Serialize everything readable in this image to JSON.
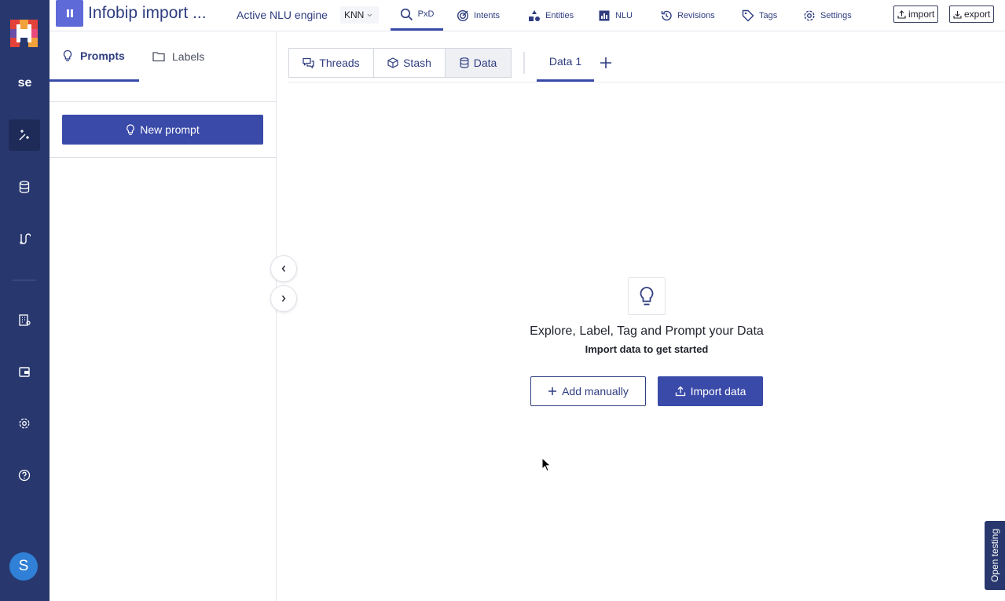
{
  "app": {
    "project_title": "Infobip import ...",
    "workspace_abbr": "se",
    "user_initial": "S"
  },
  "header": {
    "engine_label": "Active NLU engine",
    "engine_value": "KNN",
    "nav": [
      {
        "label": "PxD",
        "icon": "search-icon",
        "active": true
      },
      {
        "label": "Intents",
        "icon": "target-icon"
      },
      {
        "label": "Entities",
        "icon": "shapes-icon"
      },
      {
        "label": "NLU",
        "icon": "bar-chart-icon"
      },
      {
        "label": "Revisions",
        "icon": "history-icon"
      },
      {
        "label": "Tags",
        "icon": "tag-icon"
      },
      {
        "label": "Settings",
        "icon": "gear-icon"
      }
    ],
    "import_label": "import",
    "export_label": "export"
  },
  "left_panel": {
    "tabs": [
      {
        "label": "Prompts",
        "icon": "lightbulb-icon",
        "active": true
      },
      {
        "label": "Labels",
        "icon": "folder-icon"
      }
    ],
    "new_prompt_label": "New prompt"
  },
  "main": {
    "segments": [
      {
        "label": "Threads",
        "icon": "chat-icon"
      },
      {
        "label": "Stash",
        "icon": "box-icon"
      },
      {
        "label": "Data",
        "icon": "database-icon",
        "active": true
      }
    ],
    "data_tab_label": "Data 1",
    "empty_state": {
      "icon": "lightbulb-icon",
      "title": "Explore, Label, Tag and Prompt your Data",
      "subtitle": "Import data to get started",
      "add_manually_label": "Add manually",
      "import_data_label": "Import data"
    }
  },
  "open_testing_label": "Open testing",
  "colors": {
    "rail_bg": "#28386e",
    "accent": "#3a4aa8",
    "text_primary": "#2f3d80"
  }
}
